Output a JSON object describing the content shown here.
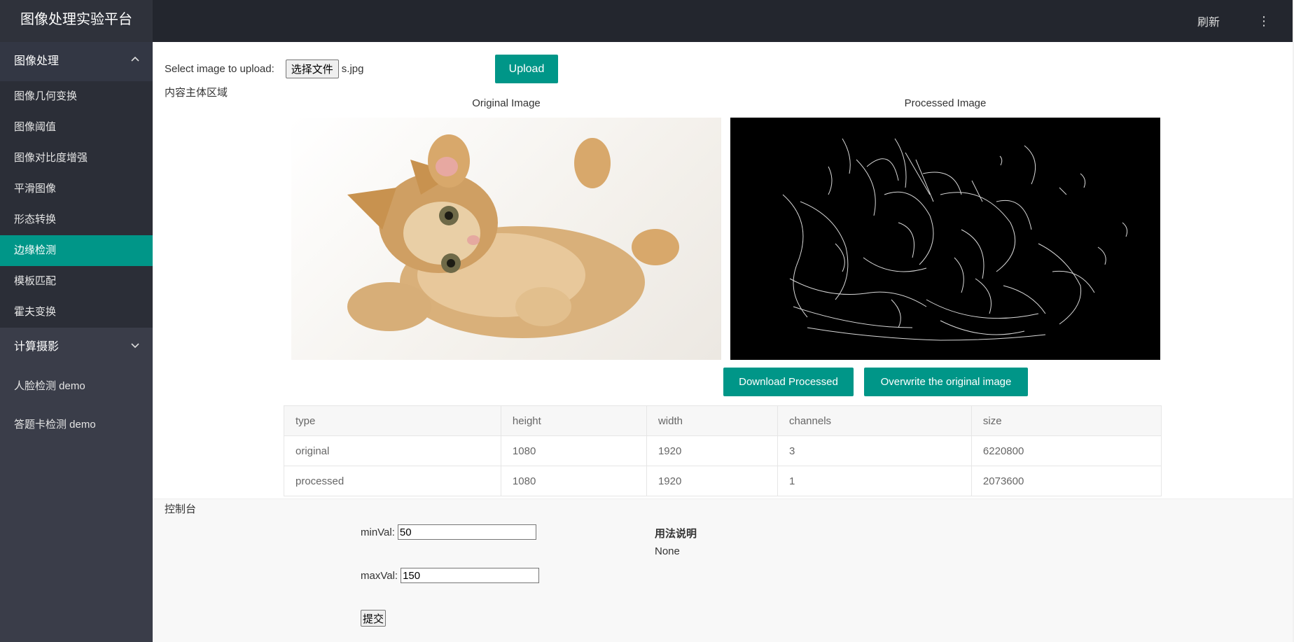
{
  "header": {
    "logo": "图像处理实验平台",
    "refresh": "刷新",
    "more": "⋮"
  },
  "sidebar": {
    "group1": {
      "label": "图像处理",
      "items": [
        "图像几何变换",
        "图像阈值",
        "图像对比度增强",
        "平滑图像",
        "形态转换",
        "边缘检测",
        "模板匹配",
        "霍夫变换"
      ],
      "active": "边缘检测"
    },
    "group2": {
      "label": "计算摄影"
    },
    "items": [
      "人脸检测 demo",
      "答题卡检测 demo"
    ]
  },
  "upload": {
    "label": "Select image to upload:",
    "file_button": "选择文件",
    "file_name": "s.jpg",
    "upload_button": "Upload"
  },
  "content_label": "内容主体区域",
  "images": {
    "original_title": "Original Image",
    "processed_title": "Processed Image"
  },
  "actions": {
    "download": "Download Processed",
    "overwrite": "Overwrite the original image"
  },
  "table": {
    "headers": [
      "type",
      "height",
      "width",
      "channels",
      "size"
    ],
    "rows": [
      [
        "original",
        "1080",
        "1920",
        "3",
        "6220800"
      ],
      [
        "processed",
        "1080",
        "1920",
        "1",
        "2073600"
      ]
    ]
  },
  "console": {
    "label": "控制台",
    "min_label": "minVal:",
    "min_value": "50",
    "max_label": "maxVal:",
    "max_value": "150",
    "submit": "提交",
    "usage_title": "用法说明",
    "usage_text": "None"
  },
  "colors": {
    "accent": "#009688",
    "header_bg": "#23262e",
    "sidebar_bg": "#3a3d49"
  }
}
